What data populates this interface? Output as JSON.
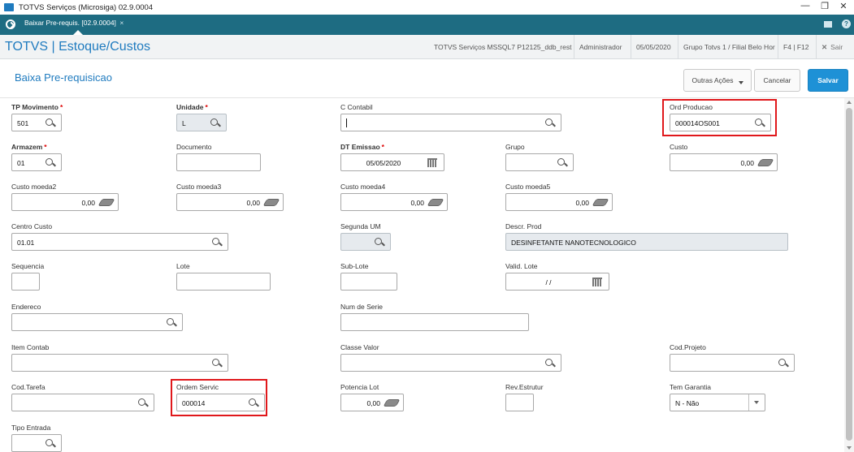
{
  "window": {
    "title": "TOTVS Serviços (Microsiga) 02.9.0004",
    "minimize": "—",
    "restore": "❐",
    "close": "✕"
  },
  "tabs": [
    {
      "label": "Baixar Pre-requis. [02.9.0004]",
      "close": "×"
    }
  ],
  "header": {
    "brand": "TOTVS | Estoque/Custos",
    "environment": "TOTVS Serviços MSSQL7 P12125_ddb_rest",
    "user": "Administrador",
    "date": "05/05/2020",
    "branch": "Grupo Totvs 1 / Filial Belo Hor",
    "shortcut": "F4 | F12",
    "exit_icon": "✕",
    "exit": "Sair"
  },
  "page": {
    "title": "Baixa Pre-requisicao",
    "buttons": {
      "other_actions": "Outras Ações",
      "cancel": "Cancelar",
      "save": "Salvar"
    }
  },
  "fields": {
    "tp_movimento": {
      "label": "TP Movimento",
      "required": "*",
      "value": "501"
    },
    "unidade": {
      "label": "Unidade",
      "required": "*",
      "value": "L"
    },
    "c_contabil": {
      "label": "C Contabil",
      "value": ""
    },
    "ord_producao": {
      "label": "Ord Producao",
      "value": "000014OS001"
    },
    "armazem": {
      "label": "Armazem",
      "required": "*",
      "value": "01"
    },
    "documento": {
      "label": "Documento",
      "value": ""
    },
    "dt_emissao": {
      "label": "DT Emissao",
      "required": "*",
      "value": "05/05/2020"
    },
    "grupo": {
      "label": "Grupo",
      "value": ""
    },
    "custo": {
      "label": "Custo",
      "value": "0,00"
    },
    "custo_moeda2": {
      "label": "Custo moeda2",
      "value": "0,00"
    },
    "custo_moeda3": {
      "label": "Custo moeda3",
      "value": "0,00"
    },
    "custo_moeda4": {
      "label": "Custo moeda4",
      "value": "0,00"
    },
    "custo_moeda5": {
      "label": "Custo moeda5",
      "value": "0,00"
    },
    "centro_custo": {
      "label": "Centro Custo",
      "value": "01.01"
    },
    "segunda_um": {
      "label": "Segunda UM",
      "value": ""
    },
    "descr_prod": {
      "label": "Descr. Prod",
      "value": "DESINFETANTE NANOTECNOLOGICO"
    },
    "sequencia": {
      "label": "Sequencia",
      "value": ""
    },
    "lote": {
      "label": "Lote",
      "value": ""
    },
    "sub_lote": {
      "label": "Sub-Lote",
      "value": ""
    },
    "valid_lote": {
      "label": "Valid. Lote",
      "value": "/ /"
    },
    "endereco": {
      "label": "Endereco",
      "value": ""
    },
    "num_serie": {
      "label": "Num de Serie",
      "value": ""
    },
    "item_contab": {
      "label": "Item Contab",
      "value": ""
    },
    "classe_valor": {
      "label": "Classe Valor",
      "value": ""
    },
    "cod_projeto": {
      "label": "Cod.Projeto",
      "value": ""
    },
    "cod_tarefa": {
      "label": "Cod.Tarefa",
      "value": ""
    },
    "ordem_servic": {
      "label": "Ordem Servic",
      "value": "000014"
    },
    "potencia_lot": {
      "label": "Potencia Lot",
      "value": "0,00"
    },
    "rev_estrutur": {
      "label": "Rev.Estrutur",
      "value": ""
    },
    "tem_garantia": {
      "label": "Tem Garantia",
      "value": "N - Não"
    },
    "tipo_entrada": {
      "label": "Tipo Entrada",
      "value": ""
    }
  },
  "colors": {
    "tab_strip": "#1e6c82",
    "brand": "#1f7bbf",
    "primary_button": "#1e91d6",
    "highlight": "#e0181b"
  }
}
